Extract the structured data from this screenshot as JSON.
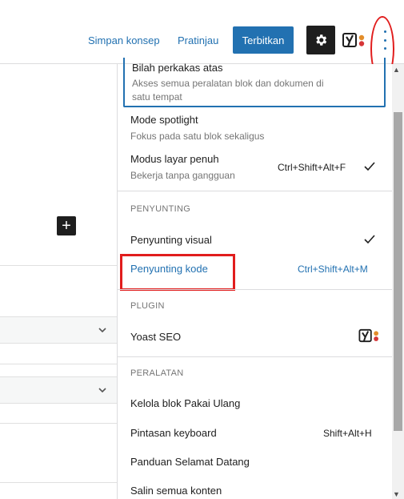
{
  "topbar": {
    "save_draft": "Simpan konsep",
    "preview": "Pratinjau",
    "publish": "Terbitkan"
  },
  "menu": {
    "toolbar_item": {
      "title": "Bilah perkakas atas",
      "desc_line1": "Akses semua peralatan blok dan dokumen di",
      "desc_line2": "satu tempat"
    },
    "spotlight": {
      "title": "Mode spotlight",
      "desc": "Fokus pada satu blok sekaligus"
    },
    "fullscreen": {
      "title": "Modus layar penuh",
      "desc": "Bekerja tanpa gangguan",
      "shortcut": "Ctrl+Shift+Alt+F"
    },
    "editor_group": "PENYUNTING",
    "visual_editor": {
      "title": "Penyunting visual"
    },
    "code_editor": {
      "title": "Penyunting kode",
      "shortcut": "Ctrl+Shift+Alt+M"
    },
    "plugin_group": "PLUGIN",
    "yoast": {
      "title": "Yoast SEO"
    },
    "tools_group": "PERALATAN",
    "reusable": {
      "title": "Kelola blok Pakai Ulang"
    },
    "keyboard": {
      "title": "Pintasan keyboard",
      "shortcut": "Shift+Alt+H"
    },
    "welcome": {
      "title": "Panduan Selamat Datang"
    },
    "copy_all": {
      "title": "Salin semua konten"
    }
  },
  "colors": {
    "accent": "#2271b1",
    "annotation": "#e11d1d",
    "dark": "#1e1e1e"
  },
  "icons": {
    "settings": "gear-icon",
    "more": "more-vertical-icon",
    "yoast": "yoast-icon",
    "check": "check-icon",
    "add": "plus-icon"
  }
}
